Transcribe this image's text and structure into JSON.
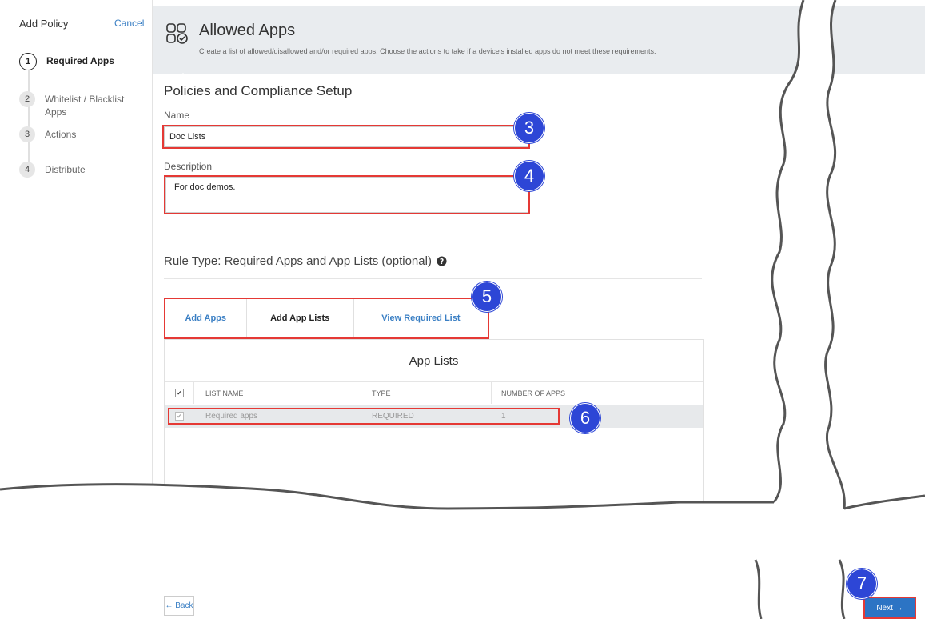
{
  "sidebar": {
    "title": "Add Policy",
    "cancel": "Cancel",
    "steps": [
      {
        "num": "1",
        "label": "Required Apps"
      },
      {
        "num": "2",
        "label": "Whitelist / Blacklist Apps"
      },
      {
        "num": "3",
        "label": "Actions"
      },
      {
        "num": "4",
        "label": "Distribute"
      }
    ]
  },
  "header": {
    "title": "Allowed Apps",
    "subtitle": "Create a list of allowed/disallowed and/or required apps. Choose the actions to take if a device's installed apps do not meet these requirements."
  },
  "form": {
    "section_title": "Policies and Compliance Setup",
    "name_label": "Name",
    "name_value": "Doc Lists",
    "description_label": "Description",
    "description_value": "For doc demos."
  },
  "rule_type": "Rule Type: Required Apps and App Lists (optional)",
  "tabs": [
    {
      "label": "Add Apps"
    },
    {
      "label": "Add App Lists"
    },
    {
      "label": "View Required List"
    }
  ],
  "app_lists": {
    "title": "App Lists",
    "headers": [
      "LIST NAME",
      "TYPE",
      "NUMBER OF APPS"
    ],
    "rows": [
      {
        "name": "Required apps",
        "type": "REQUIRED",
        "count": "1"
      }
    ]
  },
  "callouts": [
    "3",
    "4",
    "5",
    "6",
    "7"
  ],
  "footer": {
    "back": "← Back",
    "next": "Next →"
  },
  "colors": {
    "accent": "#2c74c4",
    "link": "#3a7fc4",
    "callout": "#2d46d6",
    "highlight": "#e53935"
  }
}
